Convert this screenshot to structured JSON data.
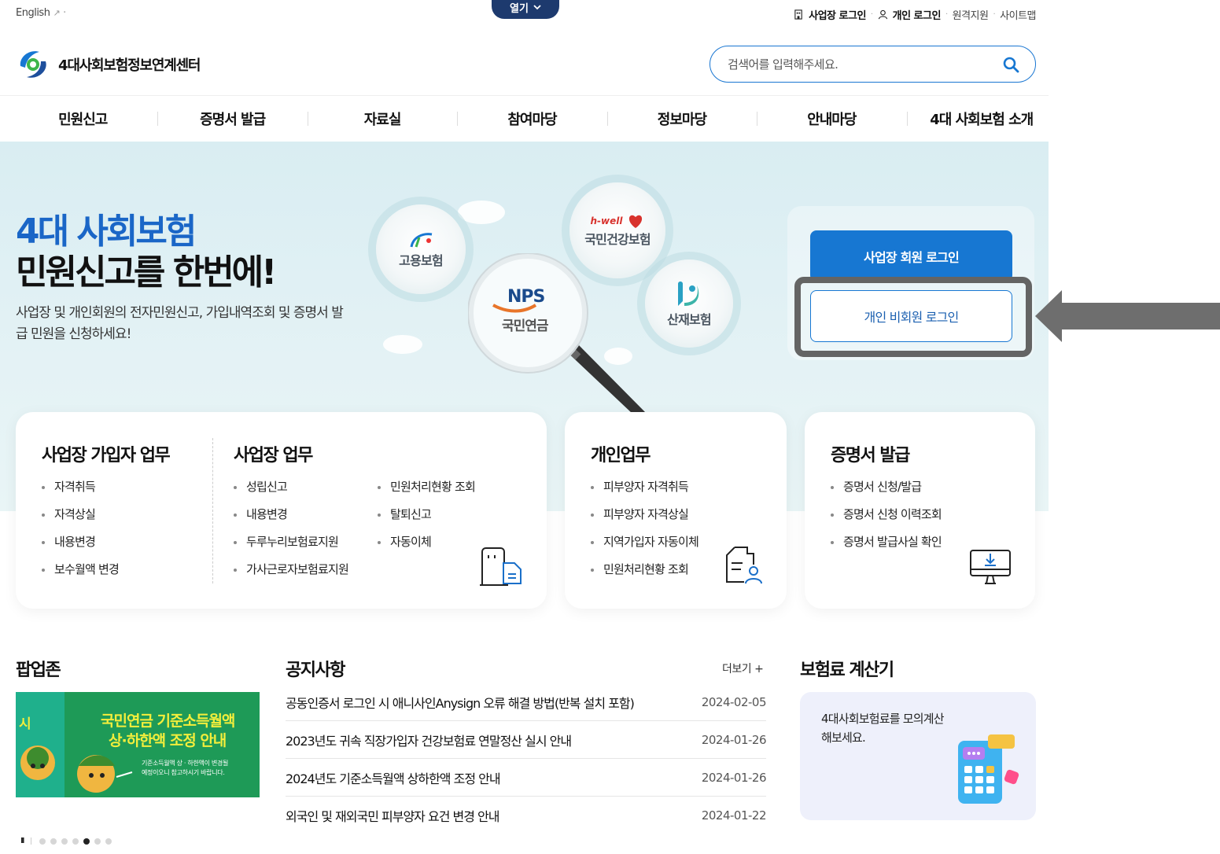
{
  "util": {
    "english": "English",
    "open_tab": "열기",
    "corp_login": "사업장 로그인",
    "personal_login": "개인 로그인",
    "remote_support": "원격지원",
    "sitemap": "사이트맵"
  },
  "logo": {
    "text": "4대사회보험정보연계센터"
  },
  "search": {
    "placeholder": "검색어를 입력해주세요."
  },
  "gnb": [
    "민원신고",
    "증명서 발급",
    "자료실",
    "참여마당",
    "정보마당",
    "안내마당",
    "4대 사회보험 소개"
  ],
  "hero": {
    "title_line1": "4대 사회보험",
    "title_line2": "민원신고를 한번에!",
    "desc": "사업장 및 개인회원의 전자민원신고, 가입내역조회 및 증명서 발급 민원을 신청하세요!",
    "bubbles": {
      "employment": "고용보험",
      "health_brand": "h-well",
      "health": "국민건강보험",
      "pension_brand": "NPS",
      "pension": "국민연금",
      "industrial": "산재보험"
    },
    "btn_corp_login": "사업장 회원 로그인",
    "btn_person_login": "개인 비회원 로그인"
  },
  "cards": {
    "corp_member": {
      "title": "사업장 가입자 업무",
      "items": [
        "자격취득",
        "자격상실",
        "내용변경",
        "보수월액 변경"
      ]
    },
    "corp": {
      "title": "사업장 업무",
      "items_col1": [
        "성립신고",
        "내용변경",
        "두루누리보험료지원",
        "가사근로자보험료지원"
      ],
      "items_col2": [
        "민원처리현황 조회",
        "탈퇴신고",
        "자동이체"
      ]
    },
    "personal": {
      "title": "개인업무",
      "items": [
        "피부양자 자격취득",
        "피부양자 자격상실",
        "지역가입자 자동이체",
        "민원처리현황 조회"
      ]
    },
    "cert": {
      "title": "증명서 발급",
      "items": [
        "증명서 신청/발급",
        "증명서 신청 이력조회",
        "증명서 발급사실 확인"
      ]
    }
  },
  "popup": {
    "title": "팝업존",
    "banner_side": "시",
    "banner_line1": "국민연금 기준소득월액",
    "banner_line2": "상·하한액 조정 안내",
    "banner_small1": "기준소득월액 상 · 하한액이 변경될",
    "banner_small2": "예정이오니 참고하시기 바랍니다.",
    "pager_pause": "II",
    "pager_active_index": 5,
    "pager_count": 7
  },
  "notice": {
    "title": "공지사항",
    "more": "더보기 +",
    "rows": [
      {
        "title": "공동인증서 로그인 시 애니사인Anysign 오류 해결 방법(반복 설치 포함)",
        "date": "2024-02-05"
      },
      {
        "title": "2023년도 귀속 직장가입자 건강보험료 연말정산 실시 안내",
        "date": "2024-01-26"
      },
      {
        "title": "2024년도 기준소득월액 상하한액 조정 안내",
        "date": "2024-01-26"
      },
      {
        "title": "외국인 및 재외국민 피부양자 요건 변경 안내",
        "date": "2024-01-22"
      }
    ]
  },
  "calculator": {
    "title": "보험료 계산기",
    "text": "4대사회보험료를 모의계산 해보세요."
  },
  "colors": {
    "primary": "#1777d2",
    "navy": "#1d3a6e",
    "hero_bg": "#dff0f4",
    "highlight": "#646464"
  }
}
